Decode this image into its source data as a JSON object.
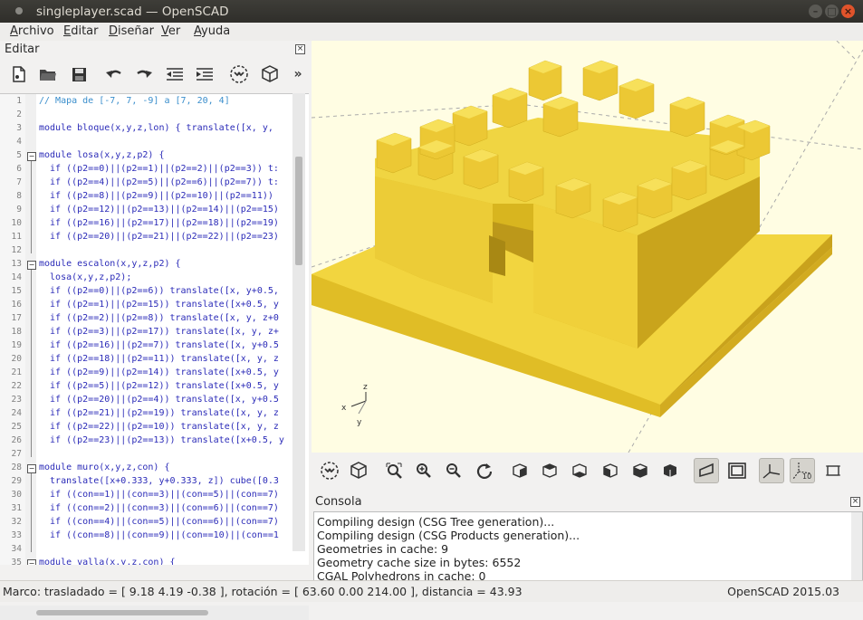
{
  "window": {
    "title": "singleplayer.scad — OpenSCAD"
  },
  "menu": [
    "Archivo",
    "Editar",
    "Diseñar",
    "Ver",
    "Ayuda"
  ],
  "editor": {
    "dock_title": "Editar",
    "toolbar_icons": [
      "new-file-icon",
      "open-folder-icon",
      "save-icon",
      "undo-icon",
      "redo-icon",
      "unindent-icon",
      "indent-icon",
      "preview-icon",
      "render-icon",
      "more-icon"
    ],
    "toolbar_more": "»",
    "lines": [
      {
        "n": "1",
        "t": "// Mapa de [-7, 7, -9] a [7, 20, 4]",
        "comment": true
      },
      {
        "n": "2",
        "t": ""
      },
      {
        "n": "3",
        "t": "module bloque(x,y,z,lon) { translate([x, y,"
      },
      {
        "n": "4",
        "t": ""
      },
      {
        "n": "5",
        "t": "module losa(x,y,z,p2) {",
        "fold": true
      },
      {
        "n": "6",
        "t": "  if ((p2==0)||(p2==1)||(p2==2)||(p2==3)) t:"
      },
      {
        "n": "7",
        "t": "  if ((p2==4)||(p2==5)||(p2==6)||(p2==7)) t:"
      },
      {
        "n": "8",
        "t": "  if ((p2==8)||(p2==9)||(p2==10)||(p2==11))"
      },
      {
        "n": "9",
        "t": "  if ((p2==12)||(p2==13)||(p2==14)||(p2==15)"
      },
      {
        "n": "10",
        "t": "  if ((p2==16)||(p2==17)||(p2==18)||(p2==19)"
      },
      {
        "n": "11",
        "t": "  if ((p2==20)||(p2==21)||(p2==22)||(p2==23)"
      },
      {
        "n": "12",
        "t": ""
      },
      {
        "n": "13",
        "t": "module escalon(x,y,z,p2) {",
        "fold": true
      },
      {
        "n": "14",
        "t": "  losa(x,y,z,p2);"
      },
      {
        "n": "15",
        "t": "  if ((p2==0)||(p2==6)) translate([x, y+0.5,"
      },
      {
        "n": "16",
        "t": "  if ((p2==1)||(p2==15)) translate([x+0.5, y"
      },
      {
        "n": "17",
        "t": "  if ((p2==2)||(p2==8)) translate([x, y, z+0"
      },
      {
        "n": "18",
        "t": "  if ((p2==3)||(p2==17)) translate([x, y, z+"
      },
      {
        "n": "19",
        "t": "  if ((p2==16)||(p2==7)) translate([x, y+0.5"
      },
      {
        "n": "20",
        "t": "  if ((p2==18)||(p2==11)) translate([x, y, z"
      },
      {
        "n": "21",
        "t": "  if ((p2==9)||(p2==14)) translate([x+0.5, y"
      },
      {
        "n": "22",
        "t": "  if ((p2==5)||(p2==12)) translate([x+0.5, y"
      },
      {
        "n": "23",
        "t": "  if ((p2==20)||(p2==4)) translate([x, y+0.5"
      },
      {
        "n": "24",
        "t": "  if ((p2==21)||(p2==19)) translate([x, y, z"
      },
      {
        "n": "25",
        "t": "  if ((p2==22)||(p2==10)) translate([x, y, z"
      },
      {
        "n": "26",
        "t": "  if ((p2==23)||(p2==13)) translate([x+0.5, y"
      },
      {
        "n": "27",
        "t": ""
      },
      {
        "n": "28",
        "t": "module muro(x,y,z,con) {",
        "fold": true
      },
      {
        "n": "29",
        "t": "  translate([x+0.333, y+0.333, z]) cube([0.3"
      },
      {
        "n": "30",
        "t": "  if ((con==1)||(con==3)||(con==5)||(con==7)"
      },
      {
        "n": "31",
        "t": "  if ((con==2)||(con==3)||(con==6)||(con==7)"
      },
      {
        "n": "32",
        "t": "  if ((con==4)||(con==5)||(con==6)||(con==7)"
      },
      {
        "n": "33",
        "t": "  if ((con==8)||(con==9)||(con==10)||(con==1"
      },
      {
        "n": "34",
        "t": ""
      },
      {
        "n": "35",
        "t": "module valla(x,y,z,con) {",
        "fold": true
      }
    ]
  },
  "viewport": {
    "background": "#fffde3",
    "model_color": "#f2d33a",
    "axis_labels": {
      "x": "x",
      "y": "y",
      "z": "z"
    }
  },
  "view_toolbar_icons": [
    "preview-icon",
    "render-icon",
    "view-all-icon",
    "zoom-in-icon",
    "zoom-out-icon",
    "reset-view-icon",
    "view-right-icon",
    "view-top-icon",
    "view-bottom-icon",
    "view-left-icon",
    "view-front-icon",
    "view-back-icon",
    "perspective-icon",
    "orthogonal-icon",
    "show-axes-icon",
    "show-scale-markers-icon",
    "show-edges-icon"
  ],
  "console": {
    "title": "Consola",
    "lines": [
      "Compiling design (CSG Tree generation)...",
      "Compiling design (CSG Products generation)...",
      "Geometries in cache: 9",
      "Geometry cache size in bytes: 6552",
      "CGAL Polyhedrons in cache: 0"
    ]
  },
  "status": {
    "left": "Marco: trasladado = [ 9.18 4.19 -0.38 ], rotación = [ 63.60 0.00 214.00 ], distancia = 43.93",
    "right": "OpenSCAD 2015.03"
  }
}
